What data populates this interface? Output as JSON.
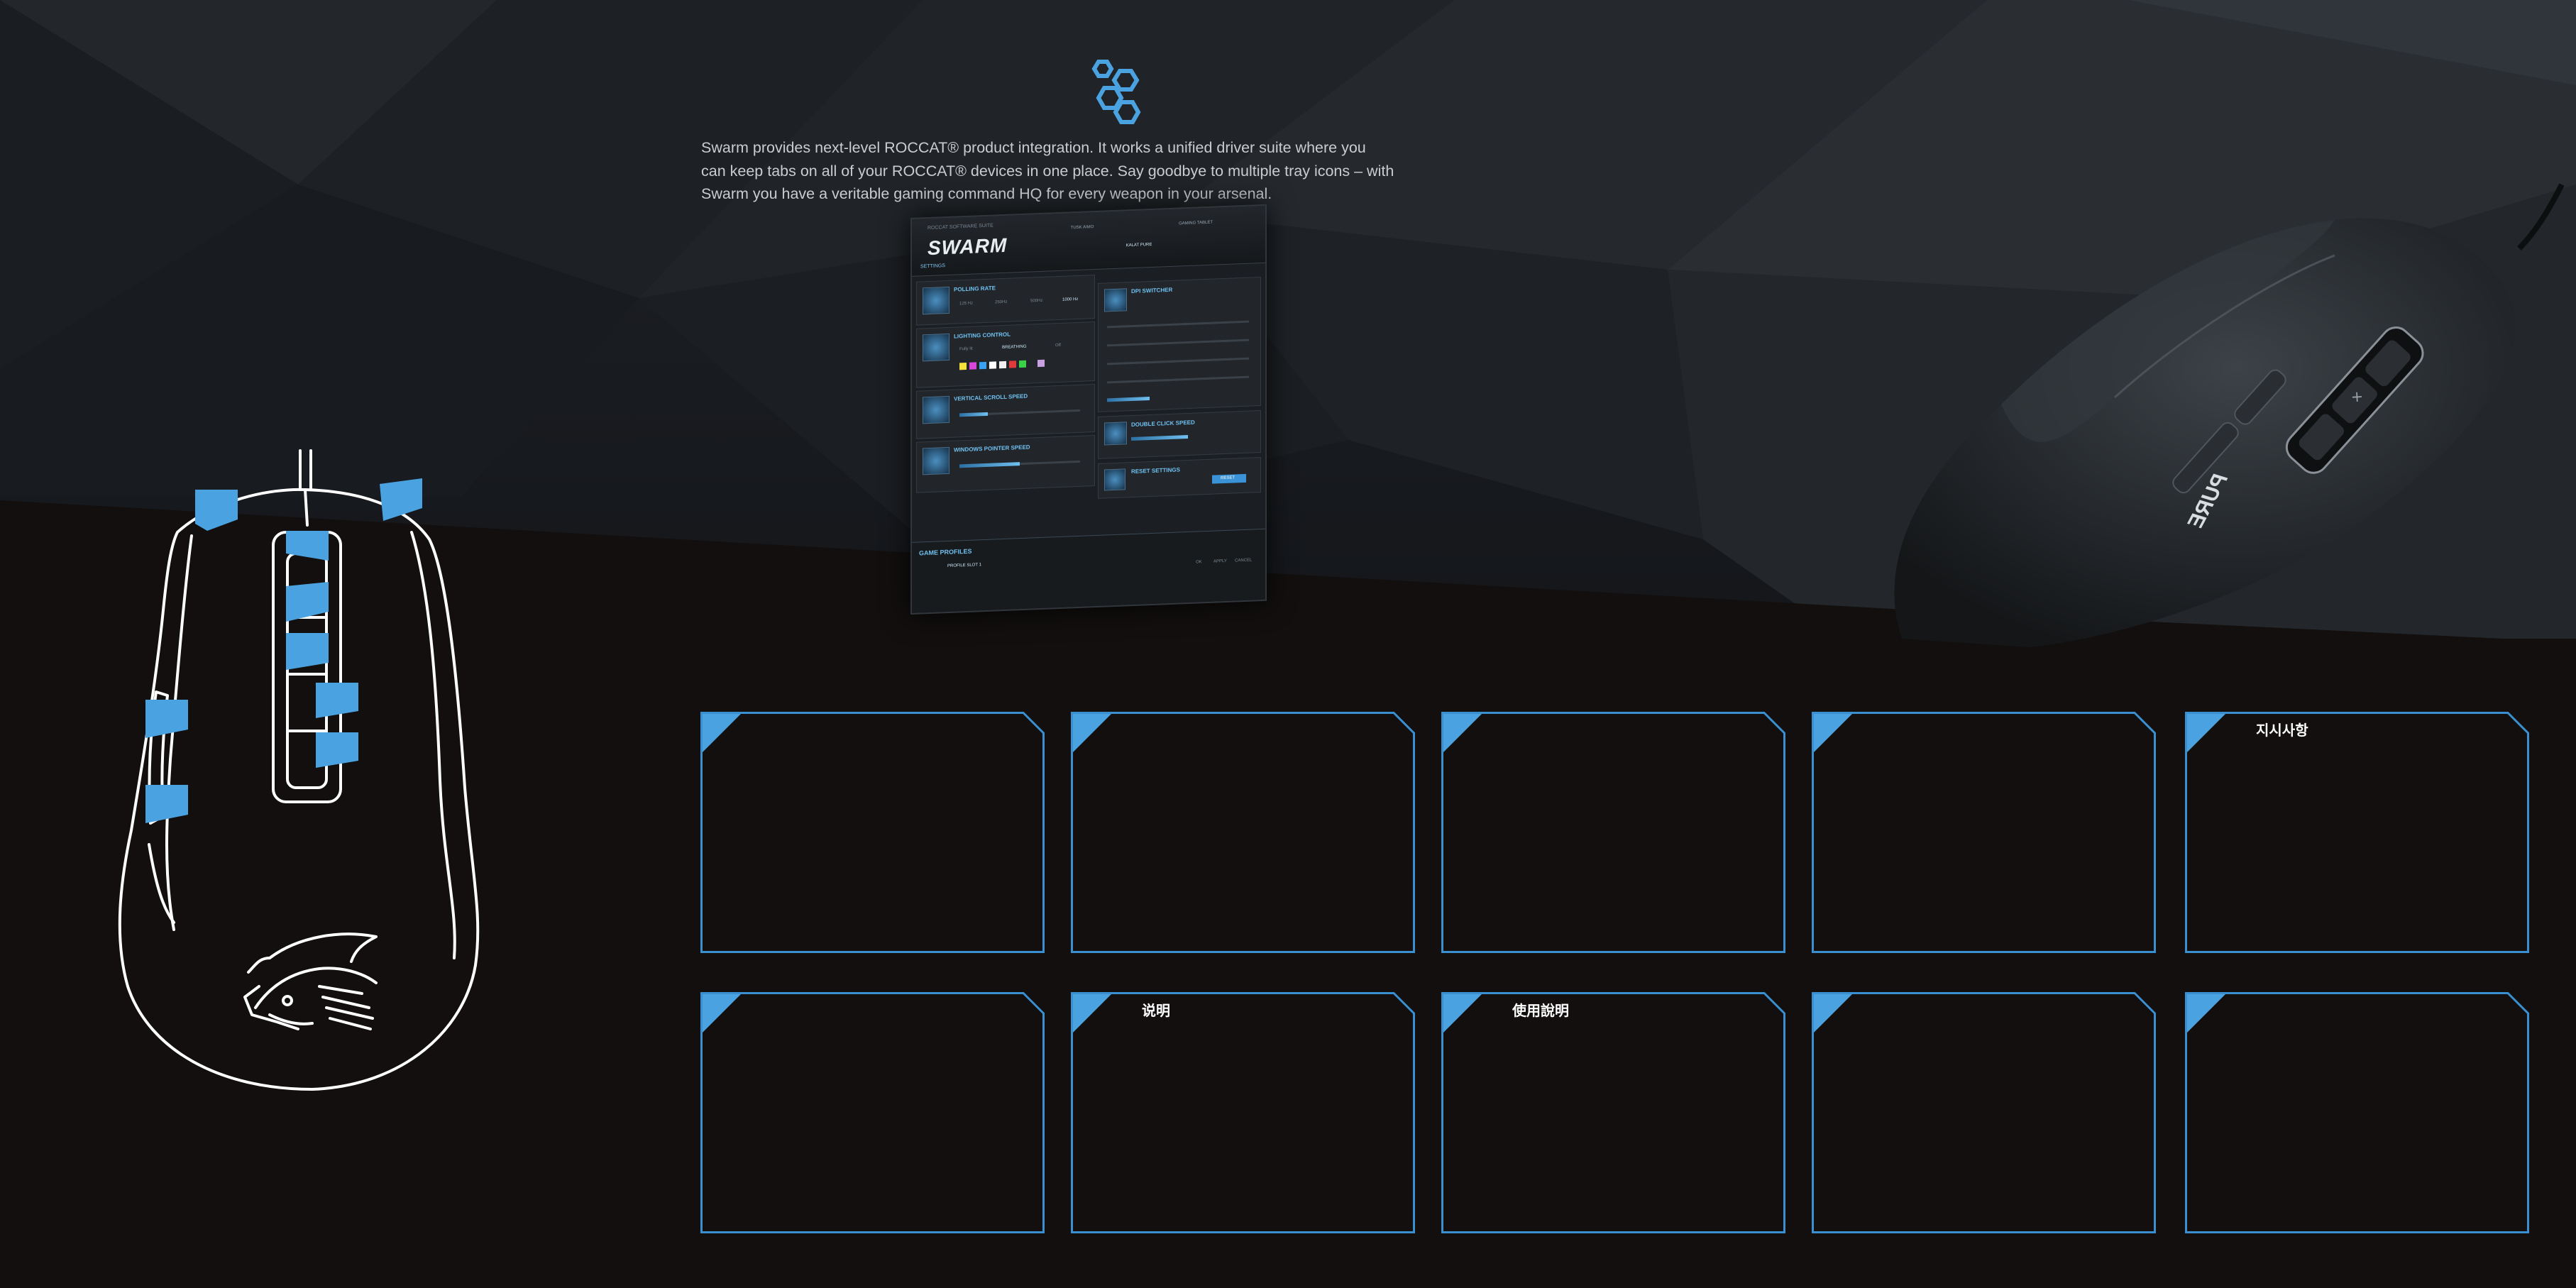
{
  "intro": {
    "line1": "Swarm provides next-level ROCCAT® product integration. It works a unified driver suite where you",
    "line2": "can keep tabs on all of your ROCCAT® devices in one place. Say goodbye to multiple tray icons – with",
    "line3": "Swarm you have a veritable gaming command HQ for every weapon in your arsenal."
  },
  "swarm_app": {
    "brand": "SWARM",
    "header_small": "ROCCAT SOFTWARE SUITE",
    "devices": [
      "TUSK AIMO",
      "KALAT PURE",
      "GAMING TABLET"
    ],
    "tab": "SETTINGS",
    "panels": [
      "POLLING RATE",
      "LIGHTING CONTROL",
      "VERTICAL SCROLL SPEED",
      "WINDOWS POINTER SPEED",
      "DPI SWITCHER",
      "DOUBLE CLICK SPEED",
      "RESET SETTINGS"
    ],
    "polling_options": [
      "125 Hz",
      "250Hz",
      "500Hz",
      "1000 Hz"
    ],
    "lighting_options": [
      "Fully lit",
      "BREATHING",
      "Off"
    ],
    "reset_button": "RESET",
    "footer_title": "GAME PROFILES",
    "profile": "PROFILE SLOT 1",
    "footer_buttons": [
      "OK",
      "APPLY",
      "CANCEL"
    ]
  },
  "colors": {
    "accent": "#4aa3e0",
    "box_border": "#3a8fd0",
    "outline": "#ffffff",
    "background": "#120f0e"
  },
  "boxes": [
    {
      "label": ""
    },
    {
      "label": ""
    },
    {
      "label": ""
    },
    {
      "label": ""
    },
    {
      "label": "지시사항"
    },
    {
      "label": ""
    },
    {
      "label": "说明"
    },
    {
      "label": "使用說明"
    },
    {
      "label": ""
    },
    {
      "label": ""
    }
  ]
}
